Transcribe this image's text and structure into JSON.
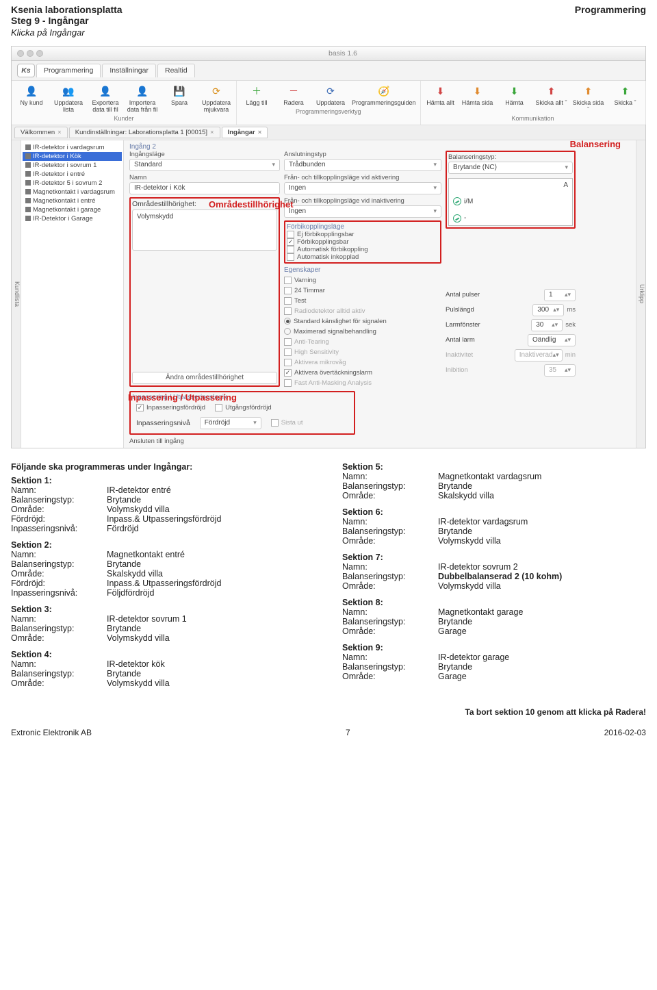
{
  "header": {
    "left": "Ksenia laborationsplatta",
    "right": "Programmering"
  },
  "step": {
    "title": "Steg 9 - Ingångar",
    "sub": "Klicka på Ingångar"
  },
  "app": {
    "title": "basis 1.6",
    "menutabs": [
      "Programmering",
      "Inställningar",
      "Realtid"
    ],
    "ribbon": {
      "kunder": {
        "label": "Kunder",
        "items": [
          {
            "id": "ny-kund",
            "label": "Ny\nkund",
            "glyph": "👤",
            "color": "#2a9d3a"
          },
          {
            "id": "uppdatera-lista",
            "label": "Uppdatera\nlista",
            "glyph": "👥",
            "color": "#2a9d3a"
          },
          {
            "id": "exportera",
            "label": "Exportera\ndata till fil",
            "glyph": "👤",
            "color": "#3b6bb5"
          },
          {
            "id": "importera",
            "label": "Importera\ndata från fil",
            "glyph": "👤",
            "color": "#3b6bb5"
          },
          {
            "id": "spara",
            "label": "Spara",
            "glyph": "💾",
            "color": "#3b6bb5"
          },
          {
            "id": "uppdatera-mjukvara",
            "label": "Uppdatera\nmjukvara",
            "glyph": "⟳",
            "color": "#d98f1a"
          }
        ]
      },
      "verktyg": {
        "label": "Programmeringsverktyg",
        "items": [
          {
            "id": "lagg-till",
            "label": "Lägg\ntill",
            "glyph": "＋",
            "color": "#3aa63a"
          },
          {
            "id": "radera",
            "label": "Radera",
            "glyph": "－",
            "color": "#d14545"
          },
          {
            "id": "uppdatera2",
            "label": "Uppdatera",
            "glyph": "⟳",
            "color": "#3b6bb5"
          },
          {
            "id": "guide",
            "label": "Programmeringsguiden",
            "glyph": "🧭",
            "color": "#3b6bb5"
          }
        ]
      },
      "komm": {
        "label": "Kommunikation",
        "items": [
          {
            "id": "hamta-allt",
            "label": "Hämta\nallt",
            "glyph": "⬇",
            "color": "#d14545"
          },
          {
            "id": "hamta-sida",
            "label": "Hämta\nsida",
            "glyph": "⬇",
            "color": "#e08a2e"
          },
          {
            "id": "hamta",
            "label": "Hämta",
            "glyph": "⬇",
            "color": "#3aa63a"
          },
          {
            "id": "skicka-allt",
            "label": "Skicka\nallt ˇ",
            "glyph": "⬆",
            "color": "#d14545"
          },
          {
            "id": "skicka-sida",
            "label": "Skicka\nsida ˇ",
            "glyph": "⬆",
            "color": "#e08a2e"
          },
          {
            "id": "skicka",
            "label": "Skicka\nˇ",
            "glyph": "⬆",
            "color": "#3aa63a"
          }
        ]
      }
    },
    "doctabs": [
      {
        "label": "Välkommen",
        "active": false
      },
      {
        "label": "Kundinställningar: Laborationsplatta 1 [00015]",
        "active": false
      },
      {
        "label": "Ingångar",
        "active": true
      }
    ],
    "siderails": {
      "left": "Kundlista",
      "right": "Urklipp"
    },
    "tree": [
      "IR-detektor i vardagsrum",
      "IR-detektor i Kök",
      "IR-detektor i sovrum 1",
      "IR-detektor i entré",
      "IR-detektor 5 i sovrum 2",
      "Magnetkontakt i vardagsrum",
      "Magnetkontakt i entré",
      "Magnetkontakt i garage",
      "IR-Detektor i Garage"
    ],
    "tree_selected": 1,
    "form": {
      "title": "Ingång 2",
      "anslutningstyp_lbl": "Anslutningstyp",
      "anslutningstyp": "Trådbunden",
      "ingangslage_lbl": "Ingångsläge",
      "ingangslage": "Standard",
      "namn_lbl": "Namn",
      "namn": "IR-detektor i Kök",
      "omr_head": "Områdestillhörighet:",
      "omr_val": "Volymskydd",
      "andra_btn": "Ändra områdestillhörighet",
      "mid": {
        "akt_lbl": "Från- och tillkopplingsläge vid aktivering",
        "akt_val": "Ingen",
        "inakt_lbl": "Från- och tillkopplingsläge vid inaktivering",
        "inakt_val": "Ingen",
        "fbk_head": "Förbikopplingsläge",
        "chk1": "Ej förbikopplingsbar",
        "chk2": "Förbikopplingsbar",
        "chk3": "Automatisk förbikoppling",
        "chk4": "Automatisk inkopplad",
        "eg_head": "Egenskaper",
        "e1": "Varning",
        "e2": "24 Timmar",
        "e3": "Test",
        "e4": "Radiodetektor alltid aktiv",
        "r1": "Standard känslighet för signalen",
        "r2": "Maximerad signalbehandling",
        "e5": "Anti-Tearing",
        "e6": "High Sensitivity",
        "e7": "Aktivera mikrovåg",
        "e8": "Aktivera övertäckningslarm",
        "e9": "Fast Anti-Masking Analysis"
      },
      "right": {
        "bal_lbl": "Balanseringstyp:",
        "bal_val": "Brytande (NC)",
        "diag_A": "A",
        "diag_iM": "i/M",
        "diag_minus": "-",
        "p1_lbl": "Antal pulser",
        "p1_val": "1",
        "p2_lbl": "Pulslängd",
        "p2_val": "300",
        "p2_unit": "ms",
        "p3_lbl": "Larmfönster",
        "p3_val": "30",
        "p3_unit": "sek",
        "p4_lbl": "Antal larm",
        "p4_val": "Oändlig",
        "p5_lbl": "Inaktivitet",
        "p5_val": "Inaktiverad",
        "p5_unit": "min",
        "p6_lbl": "Inibition",
        "p6_val": "35"
      },
      "bottom": {
        "head": "Inpassering / Utpasseringslogik",
        "c1": "Inpasseringsfördröjd",
        "c2": "Utgångsfördröjd",
        "nivalbl": "Inpasseringsnivå",
        "nivaval": "Fördröjd",
        "c3": "Sista ut"
      },
      "ansluten": "Ansluten till ingång"
    },
    "annotations": {
      "balansering": "Balansering",
      "omrade": "Områdestillhörighet",
      "inpass": "Inpassering / Utpassering"
    }
  },
  "lowtext": {
    "intro": "Följande ska programmeras under Ingångar:",
    "left": [
      {
        "title": "Sektion 1:",
        "rows": [
          [
            "Namn:",
            "IR-detektor entré"
          ],
          [
            "Balanseringstyp:",
            "Brytande"
          ],
          [
            "Område:",
            "Volymskydd villa"
          ],
          [
            "Fördröjd:",
            "Inpass.& Utpasseringsfördröjd"
          ],
          [
            "Inpasseringsnivå:",
            "Fördröjd"
          ]
        ]
      },
      {
        "title": "Sektion 2:",
        "rows": [
          [
            "Namn:",
            "Magnetkontakt entré"
          ],
          [
            "Balanseringstyp:",
            "Brytande"
          ],
          [
            "Område:",
            "Skalskydd villa"
          ],
          [
            "Fördröjd:",
            "Inpass.& Utpasseringsfördröjd"
          ],
          [
            "Inpasseringsnivå:",
            "Följdfördröjd"
          ]
        ]
      },
      {
        "title": "Sektion 3:",
        "rows": [
          [
            "Namn:",
            "IR-detektor sovrum 1"
          ],
          [
            "Balanseringstyp:",
            "Brytande"
          ],
          [
            "Område:",
            "Volymskydd villa"
          ]
        ]
      },
      {
        "title": "Sektion 4:",
        "rows": [
          [
            "Namn:",
            "IR-detektor kök"
          ],
          [
            "Balanseringstyp:",
            "Brytande"
          ],
          [
            "Område:",
            "Volymskydd villa"
          ]
        ]
      }
    ],
    "right": [
      {
        "title": "Sektion 5:",
        "rows": [
          [
            "Namn:",
            "Magnetkontakt vardagsrum"
          ],
          [
            "Balanseringstyp:",
            "Brytande"
          ],
          [
            "Område:",
            "Skalskydd villa"
          ]
        ]
      },
      {
        "title": "Sektion 6:",
        "rows": [
          [
            "Namn:",
            "IR-detektor vardagsrum"
          ],
          [
            "Balanseringstyp:",
            "Brytande"
          ],
          [
            "Område:",
            "Volymskydd villa"
          ]
        ]
      },
      {
        "title": "Sektion 7:",
        "bold7": true,
        "rows": [
          [
            "Namn:",
            "IR-detektor sovrum 2"
          ],
          [
            "Balanseringstyp:",
            "Dubbelbalanserad 2 (10 kohm)"
          ],
          [
            "Område:",
            "Volymskydd villa"
          ]
        ]
      },
      {
        "title": "Sektion 8:",
        "rows": [
          [
            "Namn:",
            "Magnetkontakt garage"
          ],
          [
            "Balanseringstyp:",
            "Brytande"
          ],
          [
            "Område:",
            "Garage"
          ]
        ]
      },
      {
        "title": "Sektion 9:",
        "rows": [
          [
            "Namn:",
            "IR-detektor garage"
          ],
          [
            "Balanseringstyp:",
            "Brytande"
          ],
          [
            "Område:",
            "Garage"
          ]
        ]
      }
    ],
    "footnote": "Ta bort sektion 10 genom att klicka på Radera!"
  },
  "footer": {
    "left": "Extronic Elektronik AB",
    "center": "7",
    "right": "2016-02-03"
  }
}
